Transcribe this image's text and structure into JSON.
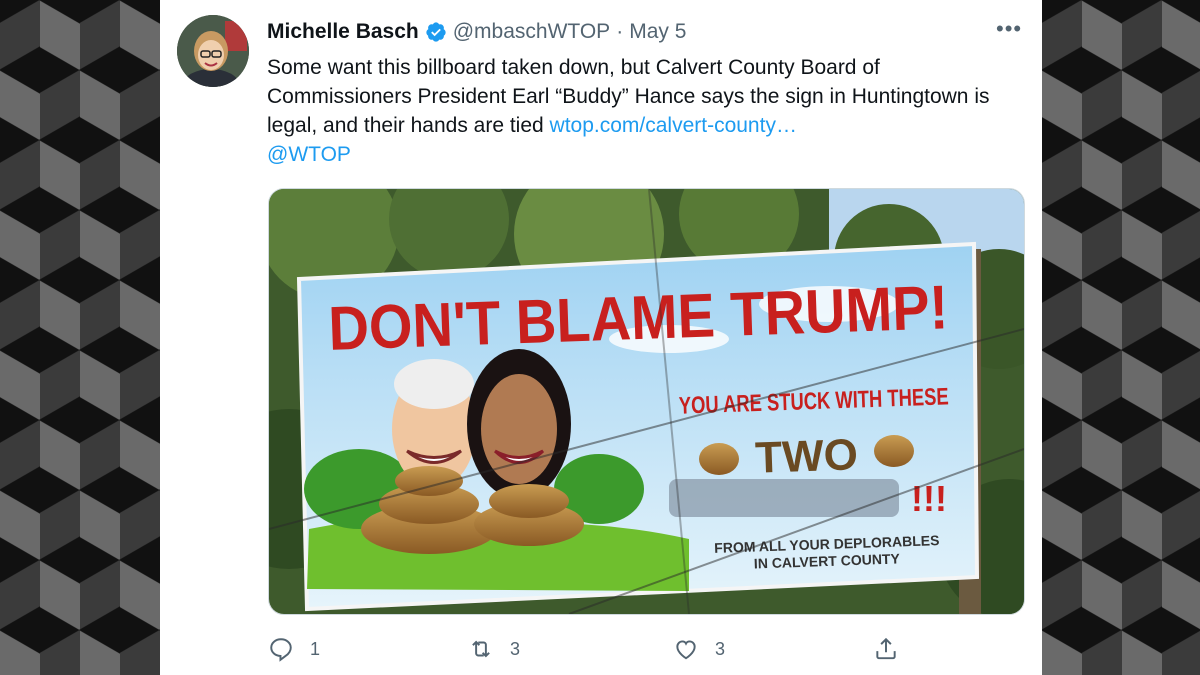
{
  "tweet": {
    "author_name": "Michelle Basch",
    "handle": "@mbaschWTOP",
    "separator": "·",
    "date": "May 5",
    "text_main": "Some want this billboard taken down, but Calvert County Board of Commissioners President Earl “Buddy” Hance says the sign in Huntingtown is legal, and their hands are tied ",
    "link_text": "wtop.com/calvert-county…",
    "mention": "@WTOP"
  },
  "billboard": {
    "headline": "DON'T BLAME TRUMP!",
    "line1": "YOU ARE STUCK WITH THESE",
    "line2": "TWO",
    "exclaim": "!!!",
    "footer1": "FROM ALL YOUR DEPLORABLES",
    "footer2": "IN CALVERT COUNTY"
  },
  "actions": {
    "reply_count": "1",
    "retweet_count": "3",
    "like_count": "3"
  },
  "colors": {
    "accent": "#1d9bf0",
    "billboard_red": "#c8201e",
    "muted": "#536471"
  },
  "icons": [
    "verified-icon",
    "more-icon",
    "reply-icon",
    "retweet-icon",
    "like-icon",
    "share-icon"
  ]
}
